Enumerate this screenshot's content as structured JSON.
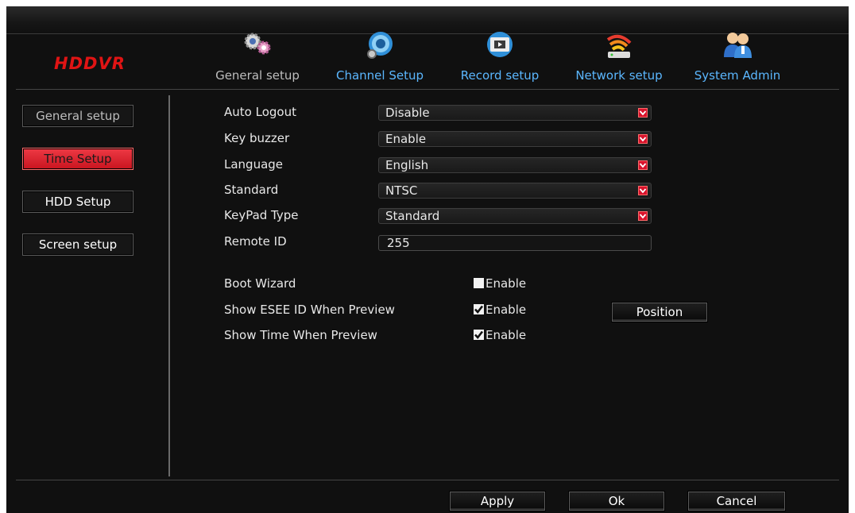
{
  "app": {
    "logo": "HDDVR"
  },
  "nav": [
    {
      "label": "General setup",
      "icon": "gears-icon",
      "active": true
    },
    {
      "label": "Channel Setup",
      "icon": "camera-icon",
      "active": false
    },
    {
      "label": "Record setup",
      "icon": "film-icon",
      "active": false
    },
    {
      "label": "Network setup",
      "icon": "wifi-icon",
      "active": false
    },
    {
      "label": "System Admin",
      "icon": "users-icon",
      "active": false
    }
  ],
  "sidebar": {
    "items": [
      {
        "label": "General setup"
      },
      {
        "label": "Time Setup",
        "active": true
      },
      {
        "label": "HDD Setup"
      },
      {
        "label": "Screen setup"
      }
    ]
  },
  "form": {
    "auto_logout": {
      "label": "Auto Logout",
      "value": "Disable"
    },
    "key_buzzer": {
      "label": "Key buzzer",
      "value": "Enable"
    },
    "language": {
      "label": "Language",
      "value": "English"
    },
    "standard": {
      "label": "Standard",
      "value": "NTSC"
    },
    "keypad_type": {
      "label": "KeyPad Type",
      "value": "Standard"
    },
    "remote_id": {
      "label": "Remote ID",
      "value": "255"
    },
    "boot_wizard": {
      "label": "Boot Wizard",
      "option": "Enable",
      "checked": false
    },
    "show_esee_id": {
      "label": "Show ESEE ID When Preview",
      "option": "Enable",
      "checked": true
    },
    "show_time": {
      "label": "Show Time When Preview",
      "option": "Enable",
      "checked": true
    },
    "position_button": "Position"
  },
  "footer": {
    "apply": "Apply",
    "ok": "Ok",
    "cancel": "Cancel"
  },
  "colors": {
    "accent_red": "#d8132c",
    "link_blue": "#5bb7ff",
    "background": "#101010"
  }
}
